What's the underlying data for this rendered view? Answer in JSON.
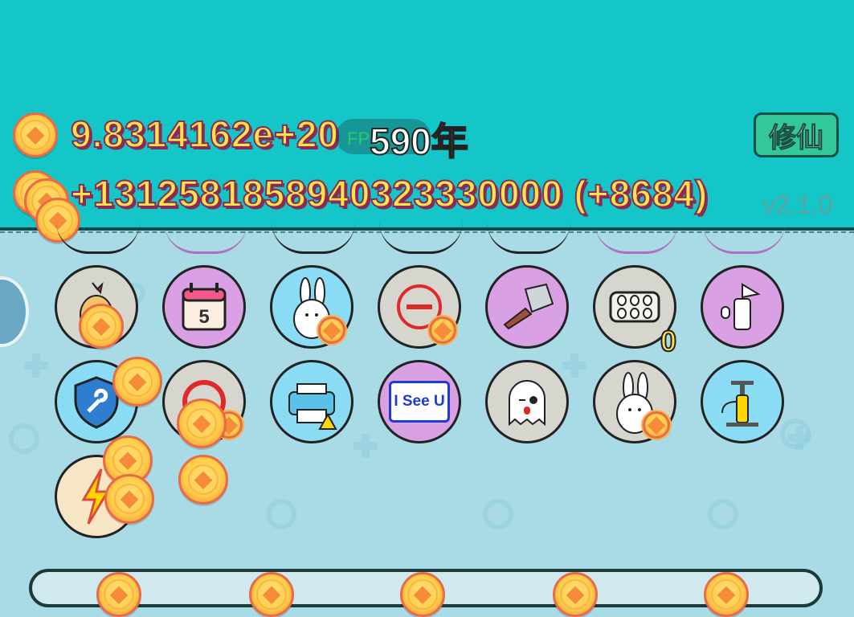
{
  "stats": {
    "total_coins": "9.8314162e+20",
    "income": "+1312581858940323330000 (+8684)",
    "years": "590年",
    "fps_overlay": "FPS"
  },
  "buttons": {
    "cultivate_label": "修仙"
  },
  "version": "v2.1.0",
  "items": {
    "calendar_day": "5",
    "egg_tray_count": "0",
    "isee_label": "I See U"
  },
  "colors": {
    "top_bar": "#14c6c8",
    "panel_bg": "#a9dbe6",
    "coin_yellow": "#ffcd4a",
    "text_yellow": "#ffe24b",
    "button_green": "#33c89a"
  }
}
